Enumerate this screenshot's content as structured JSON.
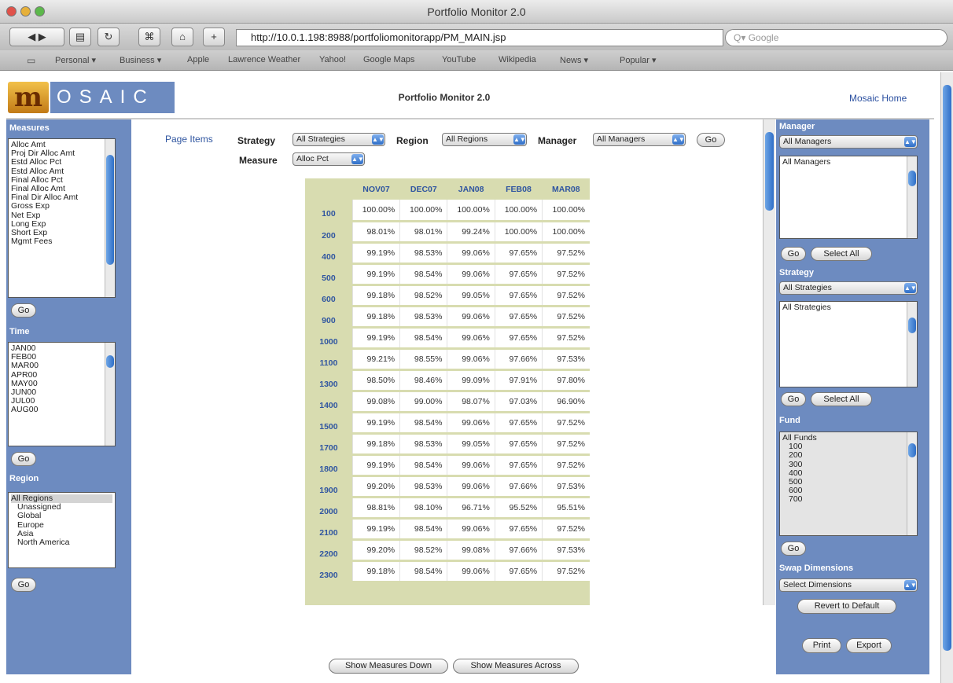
{
  "window": {
    "title": "Portfolio Monitor 2.0"
  },
  "browser": {
    "url": "http://10.0.1.198:8988/portfoliomonitorapp/PM_MAIN.jsp",
    "search_placeholder": "Google",
    "bookmarks": [
      "Personal ▾",
      "Business ▾",
      "Apple",
      "Lawrence Weather",
      "Yahoo!",
      "Google Maps",
      "YouTube",
      "Wikipedia",
      "News ▾",
      "Popular ▾"
    ]
  },
  "header": {
    "logo_mark": "m",
    "logo_text": "OSAIC",
    "title": "Portfolio Monitor 2.0",
    "home_link": "Mosaic Home"
  },
  "left": {
    "measures": {
      "title": "Measures",
      "items": [
        "Alloc Amt",
        "Proj Dir Alloc Amt",
        "Estd Alloc Pct",
        "Estd Alloc Amt",
        "Final Alloc Pct",
        "Final Alloc Amt",
        "Final Dir Alloc Amt",
        "Gross Exp",
        "Net Exp",
        "Long Exp",
        "Short Exp",
        "Mgmt Fees"
      ],
      "go": "Go"
    },
    "time": {
      "title": "Time",
      "items": [
        "JAN00",
        "FEB00",
        "MAR00",
        "APR00",
        "MAY00",
        "JUN00",
        "JUL00",
        "AUG00"
      ],
      "go": "Go"
    },
    "region": {
      "title": "Region",
      "items": [
        "All Regions",
        "Unassigned",
        "Global",
        "Europe",
        "Asia",
        "North America"
      ],
      "go": "Go"
    }
  },
  "page_items": {
    "label": "Page Items",
    "strategy_label": "Strategy",
    "strategy_value": "All Strategies",
    "region_label": "Region",
    "region_value": "All Regions",
    "manager_label": "Manager",
    "manager_value": "All Managers",
    "measure_label": "Measure",
    "measure_value": "Alloc Pct",
    "go": "Go"
  },
  "table": {
    "columns": [
      "NOV07",
      "DEC07",
      "JAN08",
      "FEB08",
      "MAR08"
    ],
    "rows": [
      {
        "id": "100",
        "values": [
          "100.00%",
          "100.00%",
          "100.00%",
          "100.00%",
          "100.00%"
        ]
      },
      {
        "id": "200",
        "values": [
          "98.01%",
          "98.01%",
          "99.24%",
          "100.00%",
          "100.00%"
        ]
      },
      {
        "id": "400",
        "values": [
          "99.19%",
          "98.53%",
          "99.06%",
          "97.65%",
          "97.52%"
        ]
      },
      {
        "id": "500",
        "values": [
          "99.19%",
          "98.54%",
          "99.06%",
          "97.65%",
          "97.52%"
        ]
      },
      {
        "id": "600",
        "values": [
          "99.18%",
          "98.52%",
          "99.05%",
          "97.65%",
          "97.52%"
        ]
      },
      {
        "id": "900",
        "values": [
          "99.18%",
          "98.53%",
          "99.06%",
          "97.65%",
          "97.52%"
        ]
      },
      {
        "id": "1000",
        "values": [
          "99.19%",
          "98.54%",
          "99.06%",
          "97.65%",
          "97.52%"
        ]
      },
      {
        "id": "1100",
        "values": [
          "99.21%",
          "98.55%",
          "99.06%",
          "97.66%",
          "97.53%"
        ]
      },
      {
        "id": "1300",
        "values": [
          "98.50%",
          "98.46%",
          "99.09%",
          "97.91%",
          "97.80%"
        ]
      },
      {
        "id": "1400",
        "values": [
          "99.08%",
          "99.00%",
          "98.07%",
          "97.03%",
          "96.90%"
        ]
      },
      {
        "id": "1500",
        "values": [
          "99.19%",
          "98.54%",
          "99.06%",
          "97.65%",
          "97.52%"
        ]
      },
      {
        "id": "1700",
        "values": [
          "99.18%",
          "98.53%",
          "99.05%",
          "97.65%",
          "97.52%"
        ]
      },
      {
        "id": "1800",
        "values": [
          "99.19%",
          "98.54%",
          "99.06%",
          "97.65%",
          "97.52%"
        ]
      },
      {
        "id": "1900",
        "values": [
          "99.20%",
          "98.53%",
          "99.06%",
          "97.66%",
          "97.53%"
        ]
      },
      {
        "id": "2000",
        "values": [
          "98.81%",
          "98.10%",
          "96.71%",
          "95.52%",
          "95.51%"
        ]
      },
      {
        "id": "2100",
        "values": [
          "99.19%",
          "98.54%",
          "99.06%",
          "97.65%",
          "97.52%"
        ]
      },
      {
        "id": "2200",
        "values": [
          "99.20%",
          "98.52%",
          "99.08%",
          "97.66%",
          "97.53%"
        ]
      },
      {
        "id": "2300",
        "values": [
          "99.18%",
          "98.54%",
          "99.06%",
          "97.65%",
          "97.52%"
        ]
      }
    ]
  },
  "bottom_buttons": {
    "down": "Show Measures Down",
    "across": "Show Measures Across"
  },
  "right": {
    "manager": {
      "title": "Manager",
      "select": "All Managers",
      "items": [
        "All Managers"
      ],
      "go": "Go",
      "select_all": "Select All"
    },
    "strategy": {
      "title": "Strategy",
      "select": "All Strategies",
      "items": [
        "All Strategies"
      ],
      "go": "Go",
      "select_all": "Select All"
    },
    "fund": {
      "title": "Fund",
      "items": [
        "All Funds",
        "100",
        "200",
        "300",
        "400",
        "500",
        "600",
        "700"
      ],
      "go": "Go"
    },
    "swap": {
      "title": "Swap Dimensions",
      "select": "Select Dimensions"
    },
    "revert": "Revert to Default",
    "print": "Print",
    "export": "Export"
  }
}
